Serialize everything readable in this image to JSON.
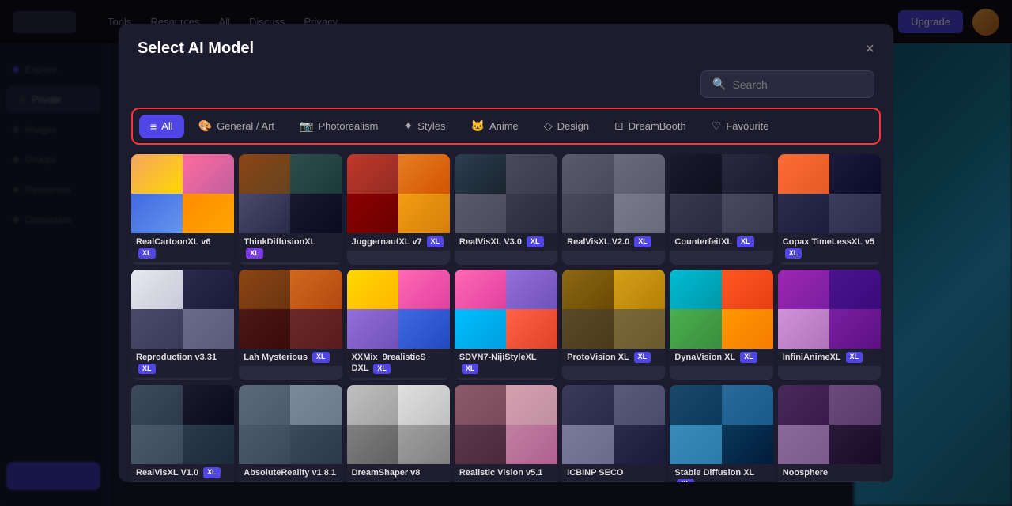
{
  "modal": {
    "title": "Select AI Model",
    "close_label": "×",
    "search": {
      "placeholder": "Search"
    }
  },
  "filter_tabs": [
    {
      "id": "all",
      "label": "All",
      "icon": "≡≡≡",
      "active": true
    },
    {
      "id": "general",
      "label": "General / Art",
      "icon": "🎨"
    },
    {
      "id": "photorealism",
      "label": "Photorealism",
      "icon": "📷"
    },
    {
      "id": "styles",
      "label": "Styles",
      "icon": "✦"
    },
    {
      "id": "anime",
      "label": "Anime",
      "icon": "🐱"
    },
    {
      "id": "design",
      "label": "Design",
      "icon": "◇"
    },
    {
      "id": "dreambooth",
      "label": "DreamBooth",
      "icon": "⊡"
    },
    {
      "id": "favourite",
      "label": "Favourite",
      "icon": "♡"
    }
  ],
  "models": [
    {
      "name": "RealCartoonXL",
      "version": "v6",
      "badge": "XL",
      "badge_type": "xl",
      "colors": [
        "#f4a460",
        "#ff6b9d",
        "#4169e1",
        "#ffd700"
      ]
    },
    {
      "name": "ThinkDiffusionXL",
      "version": "",
      "badge": "XL",
      "badge_type": "purple",
      "colors": [
        "#8b4513",
        "#2f4f4f",
        "#1a1a2e",
        "#4a4a6a"
      ]
    },
    {
      "name": "JuggernautXL",
      "version": "v7",
      "badge": "XL",
      "badge_type": "xl",
      "colors": [
        "#c0392b",
        "#e74c3c",
        "#f39c12",
        "#8b0000"
      ]
    },
    {
      "name": "RealVisXL",
      "version": "V3.0",
      "badge": "XL",
      "badge_type": "xl",
      "colors": [
        "#2c3e50",
        "#34495e",
        "#7f8c8d",
        "#1a252f"
      ]
    },
    {
      "name": "RealVisXL",
      "version": "V2.0",
      "badge": "XL",
      "badge_type": "xl",
      "colors": [
        "#4a4a5a",
        "#6a6a7a",
        "#3a3a4a",
        "#5a5a6a"
      ]
    },
    {
      "name": "CounterfeitXL",
      "version": "",
      "badge": "XL",
      "badge_type": "xl",
      "colors": [
        "#1a1a2e",
        "#2a2a3e",
        "#3a3a4e",
        "#4a4a5e"
      ]
    },
    {
      "name": "Copax TimeLessXL",
      "version": "v5",
      "badge": "XL",
      "badge_type": "xl",
      "colors": [
        "#ff6b35",
        "#2c2c4c",
        "#1a1a3a",
        "#3c3c5c"
      ]
    },
    {
      "name": "Reproduction",
      "version": "v3.31",
      "badge": "XL",
      "badge_type": "xl",
      "colors": [
        "#e8e8f0",
        "#4a4a6a",
        "#2a2a4a",
        "#6a6a8a"
      ]
    },
    {
      "name": "Lah Mysterious",
      "version": "",
      "badge": "XL",
      "badge_type": "xl",
      "colors": [
        "#8b4513",
        "#d2691e",
        "#4a1a1a",
        "#6b2a2a"
      ]
    },
    {
      "name": "XXMix_9realisticS DXL",
      "version": "",
      "badge": "XL",
      "badge_type": "xl",
      "colors": [
        "#ffd700",
        "#ff69b4",
        "#9370db",
        "#4169e1"
      ]
    },
    {
      "name": "SDVN7-NijiStyleXL",
      "version": "",
      "badge": "XL",
      "badge_type": "xl",
      "colors": [
        "#ff69b4",
        "#9370db",
        "#00bfff",
        "#ff6347"
      ]
    },
    {
      "name": "ProtoVision XL",
      "version": "",
      "badge": "XL",
      "badge_type": "xl",
      "colors": [
        "#8b6914",
        "#d4a017",
        "#5a4a2a",
        "#7a6a3a"
      ]
    },
    {
      "name": "DynaVision XL",
      "version": "",
      "badge": "XL",
      "badge_type": "xl",
      "colors": [
        "#00bcd4",
        "#0097a7",
        "#ff5722",
        "#4caf50"
      ]
    },
    {
      "name": "InfiniAnimeXL",
      "version": "",
      "badge": "XL",
      "badge_type": "xl",
      "colors": [
        "#9c27b0",
        "#7b1fa2",
        "#4a148c",
        "#ce93d8"
      ]
    },
    {
      "name": "RealVisXL",
      "version": "V1.0",
      "badge": "XL",
      "badge_type": "xl",
      "colors": [
        "#2c2c3c",
        "#3c3c4c",
        "#4c4c5c",
        "#5c5c6c"
      ]
    },
    {
      "name": "AbsoluteReality",
      "version": "v1.8.1",
      "badge": "",
      "badge_type": "",
      "colors": [
        "#5a6a7a",
        "#7a8a9a",
        "#4a5a6a",
        "#3a4a5a"
      ]
    },
    {
      "name": "DreamShaper v8",
      "version": "",
      "badge": "",
      "badge_type": "",
      "colors": [
        "#c0c0c0",
        "#a0a0a0",
        "#808080",
        "#e0e0e0"
      ]
    },
    {
      "name": "Realistic Vision",
      "version": "v5.1",
      "badge": "",
      "badge_type": "",
      "colors": [
        "#8b5a6a",
        "#d4a0b0",
        "#5a3a4a",
        "#c080a0"
      ]
    },
    {
      "name": "ICBINP SECO",
      "version": "",
      "badge": "",
      "badge_type": "",
      "colors": [
        "#3a3a5a",
        "#5a5a7a",
        "#7a7a9a",
        "#2a2a4a"
      ]
    },
    {
      "name": "Stable Diffusion XL",
      "version": "",
      "badge": "XL",
      "badge_type": "xl",
      "colors": [
        "#1a4a6a",
        "#2a6a9a",
        "#3a8aba",
        "#0a3a5a"
      ]
    },
    {
      "name": "Noosphere",
      "version": "",
      "badge": "",
      "badge_type": "",
      "colors": [
        "#4a2a5a",
        "#6a4a7a",
        "#8a6a9a",
        "#2a1a3a"
      ]
    }
  ],
  "topbar": {
    "nav_items": [
      "Tools",
      "Resources",
      "All",
      "Discuss",
      "Privacy"
    ],
    "cta_label": "Upgrade",
    "logo_text": ""
  },
  "sidebar": {
    "items": [
      "Explore",
      "Private",
      "Images",
      "Groups",
      "Resources",
      "Discussion"
    ]
  }
}
